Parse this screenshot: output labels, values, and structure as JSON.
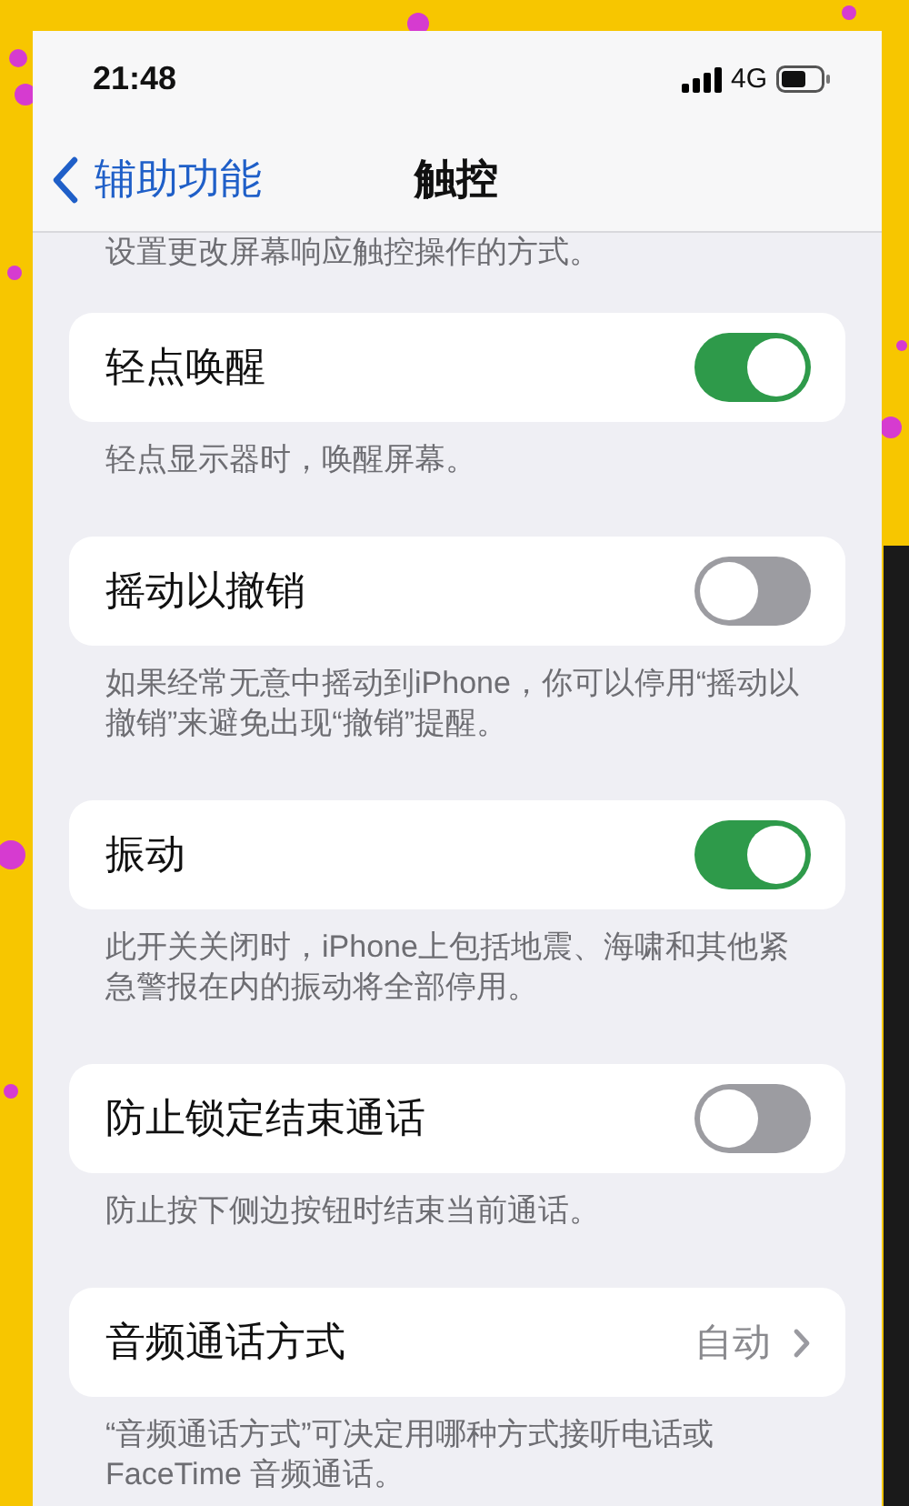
{
  "status_bar": {
    "time": "21:48",
    "network": "4G"
  },
  "nav": {
    "back_label": "辅助功能",
    "title": "触控"
  },
  "intro": "设置更改屏幕响应触控操作的方式。",
  "sections": [
    {
      "kind": "toggle",
      "label": "轻点唤醒",
      "on": true,
      "footer": "轻点显示器时，唤醒屏幕。"
    },
    {
      "kind": "toggle",
      "label": "摇动以撤销",
      "on": false,
      "footer": "如果经常无意中摇动到iPhone，你可以停用“摇动以撤销”来避免出现“撤销”提醒。"
    },
    {
      "kind": "toggle",
      "label": "振动",
      "on": true,
      "footer": "此开关关闭时，iPhone上包括地震、海啸和其他紧急警报在内的振动将全部停用。"
    },
    {
      "kind": "toggle",
      "label": "防止锁定结束通话",
      "on": false,
      "footer": "防止按下侧边按钮时结束当前通话。"
    },
    {
      "kind": "link",
      "label": "音频通话方式",
      "value": "自动",
      "footer": "“音频通话方式”可决定用哪种方式接听电话或FaceTime 音频通话。"
    }
  ]
}
